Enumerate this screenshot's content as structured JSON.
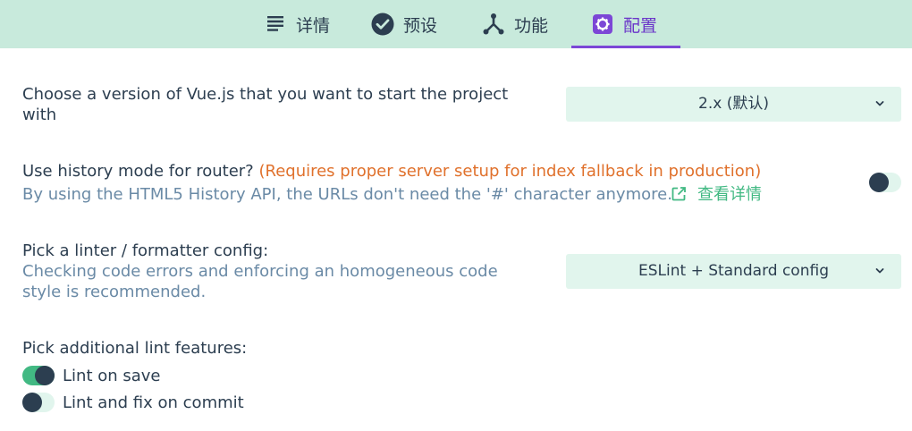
{
  "tabs": [
    {
      "label": "详情",
      "icon": "list-icon",
      "active": false
    },
    {
      "label": "预设",
      "icon": "check-circle-icon",
      "active": false
    },
    {
      "label": "功能",
      "icon": "fork-icon",
      "active": false
    },
    {
      "label": "配置",
      "icon": "gear-icon",
      "active": true
    }
  ],
  "settings": {
    "vue_version": {
      "label_line1": "Choose a version of Vue.js that you want to start the project",
      "label_line2": "with",
      "selected": "2.x (默认)"
    },
    "history_mode": {
      "label": "Use history mode for router?",
      "warning": "(Requires proper server setup for index fallback in production)",
      "description": "By using the HTML5 History API, the URLs don't need the '#' character anymore.",
      "link_label": "查看详情",
      "enabled": false
    },
    "linter": {
      "label": "Pick a linter / formatter config:",
      "description_line1": "Checking code errors and enforcing an homogeneous code",
      "description_line2": "style is recommended.",
      "selected": "ESLint + Standard config"
    },
    "lint_features": {
      "label": "Pick additional lint features:",
      "options": [
        {
          "label": "Lint on save",
          "enabled": true
        },
        {
          "label": "Lint and fix on commit",
          "enabled": false
        }
      ]
    }
  },
  "colors": {
    "tabbar_bg": "#c8eadc",
    "accent_purple": "#7c47d6",
    "accent_green": "#42b983",
    "warning_orange": "#e0712c",
    "text_dark": "#2c3e50",
    "text_muted": "#6a8aa6",
    "control_bg": "#e1f5ed"
  }
}
